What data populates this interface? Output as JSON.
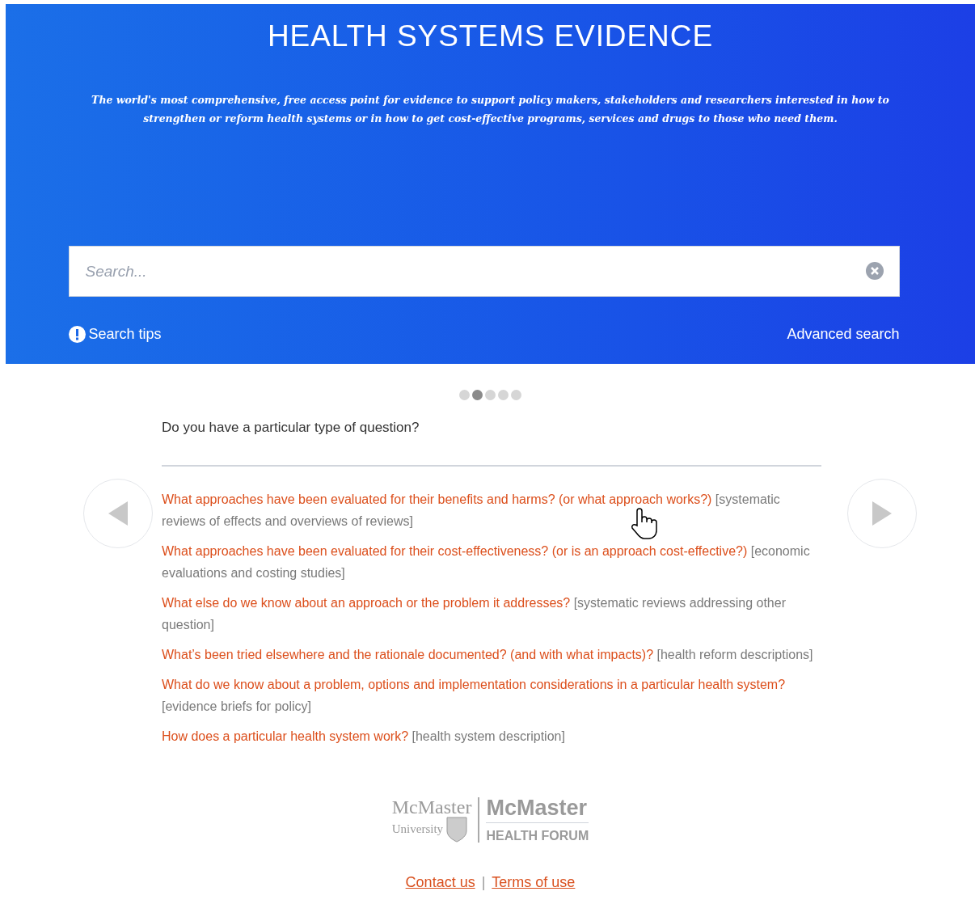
{
  "header": {
    "title": "HEALTH SYSTEMS EVIDENCE",
    "tagline": "The world's most comprehensive, free access point for evidence to support policy makers, stakeholders and researchers interested in how to strengthen or reform health systems or in how to get cost-effective programs, services and drugs to those who need them."
  },
  "search": {
    "placeholder": "Search...",
    "tips_label": "Search tips",
    "advanced_label": "Advanced search"
  },
  "carousel": {
    "dots": [
      {
        "selected": false
      },
      {
        "selected": true
      },
      {
        "selected": false
      },
      {
        "selected": false
      },
      {
        "selected": false
      }
    ],
    "heading": "Do you have a particular type of question?",
    "questions": [
      {
        "question": "What approaches have been evaluated for their benefits and harms? (or what approach works?)",
        "category": "[systematic reviews of effects and overviews of reviews]"
      },
      {
        "question": "What approaches have been evaluated for their cost-effectiveness? (or is an approach cost-effective?)",
        "category": "[economic evaluations and costing studies]"
      },
      {
        "question": "What else do we know about an approach or the problem it addresses?",
        "category": "[systematic reviews addressing other question]"
      },
      {
        "question": "What’s been tried elsewhere and the rationale documented? (and with what impacts)?",
        "category": "[health reform descriptions]"
      },
      {
        "question": "What do we know about a problem, options and implementation considerations in a particular health system?",
        "category": "[evidence briefs for policy]"
      },
      {
        "question": "How does a particular health system work?",
        "category": "[health system description]"
      }
    ]
  },
  "footer": {
    "logo_left": [
      "McMaster",
      "University"
    ],
    "logo_right": [
      "McMaster",
      "HEALTH FORUM"
    ],
    "links": [
      "Contact us",
      "Terms of use"
    ],
    "separator": "|"
  }
}
